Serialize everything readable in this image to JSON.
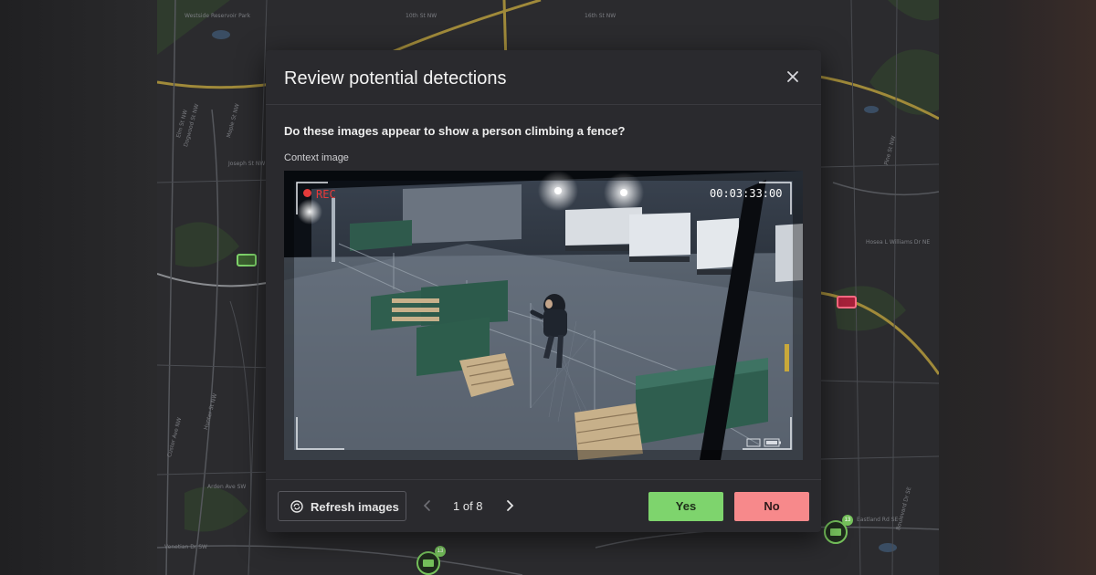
{
  "dialog": {
    "title": "Review potential detections",
    "question": "Do these images appear to show a person climbing a fence?",
    "context_label": "Context image",
    "context_image": {
      "rec_label": "REC",
      "timecode": "00:03:33:00"
    },
    "footer": {
      "refresh_label": "Refresh images",
      "pager_text": "1 of 8",
      "yes_label": "Yes",
      "no_label": "No"
    }
  },
  "map": {
    "labels": [
      "Westside Reservoir Park",
      "10th St NW",
      "16th St NW",
      "Elm St NW",
      "Maple St NW",
      "Dogwood St NW",
      "Joseph St NW",
      "Hosea L Williams Dr NE",
      "Pine St NW",
      "Custer Ave NW",
      "Hunter St NW",
      "Venetian Dr SW",
      "Arden Ave SW",
      "Eastland Rd SE",
      "Boulevard Dr SE"
    ],
    "markers": [
      {
        "type": "camera",
        "status": "normal",
        "color": "#7fd46b"
      },
      {
        "type": "camera",
        "status": "alert",
        "color": "#ff6b84"
      },
      {
        "type": "camera-cluster",
        "count": "13"
      },
      {
        "type": "camera-cluster",
        "count": "13"
      }
    ]
  },
  "colors": {
    "yes": "#7ed46d",
    "no": "#f7898b",
    "rec": "#e53a3a",
    "dialog_bg": "#2a2a2e"
  }
}
